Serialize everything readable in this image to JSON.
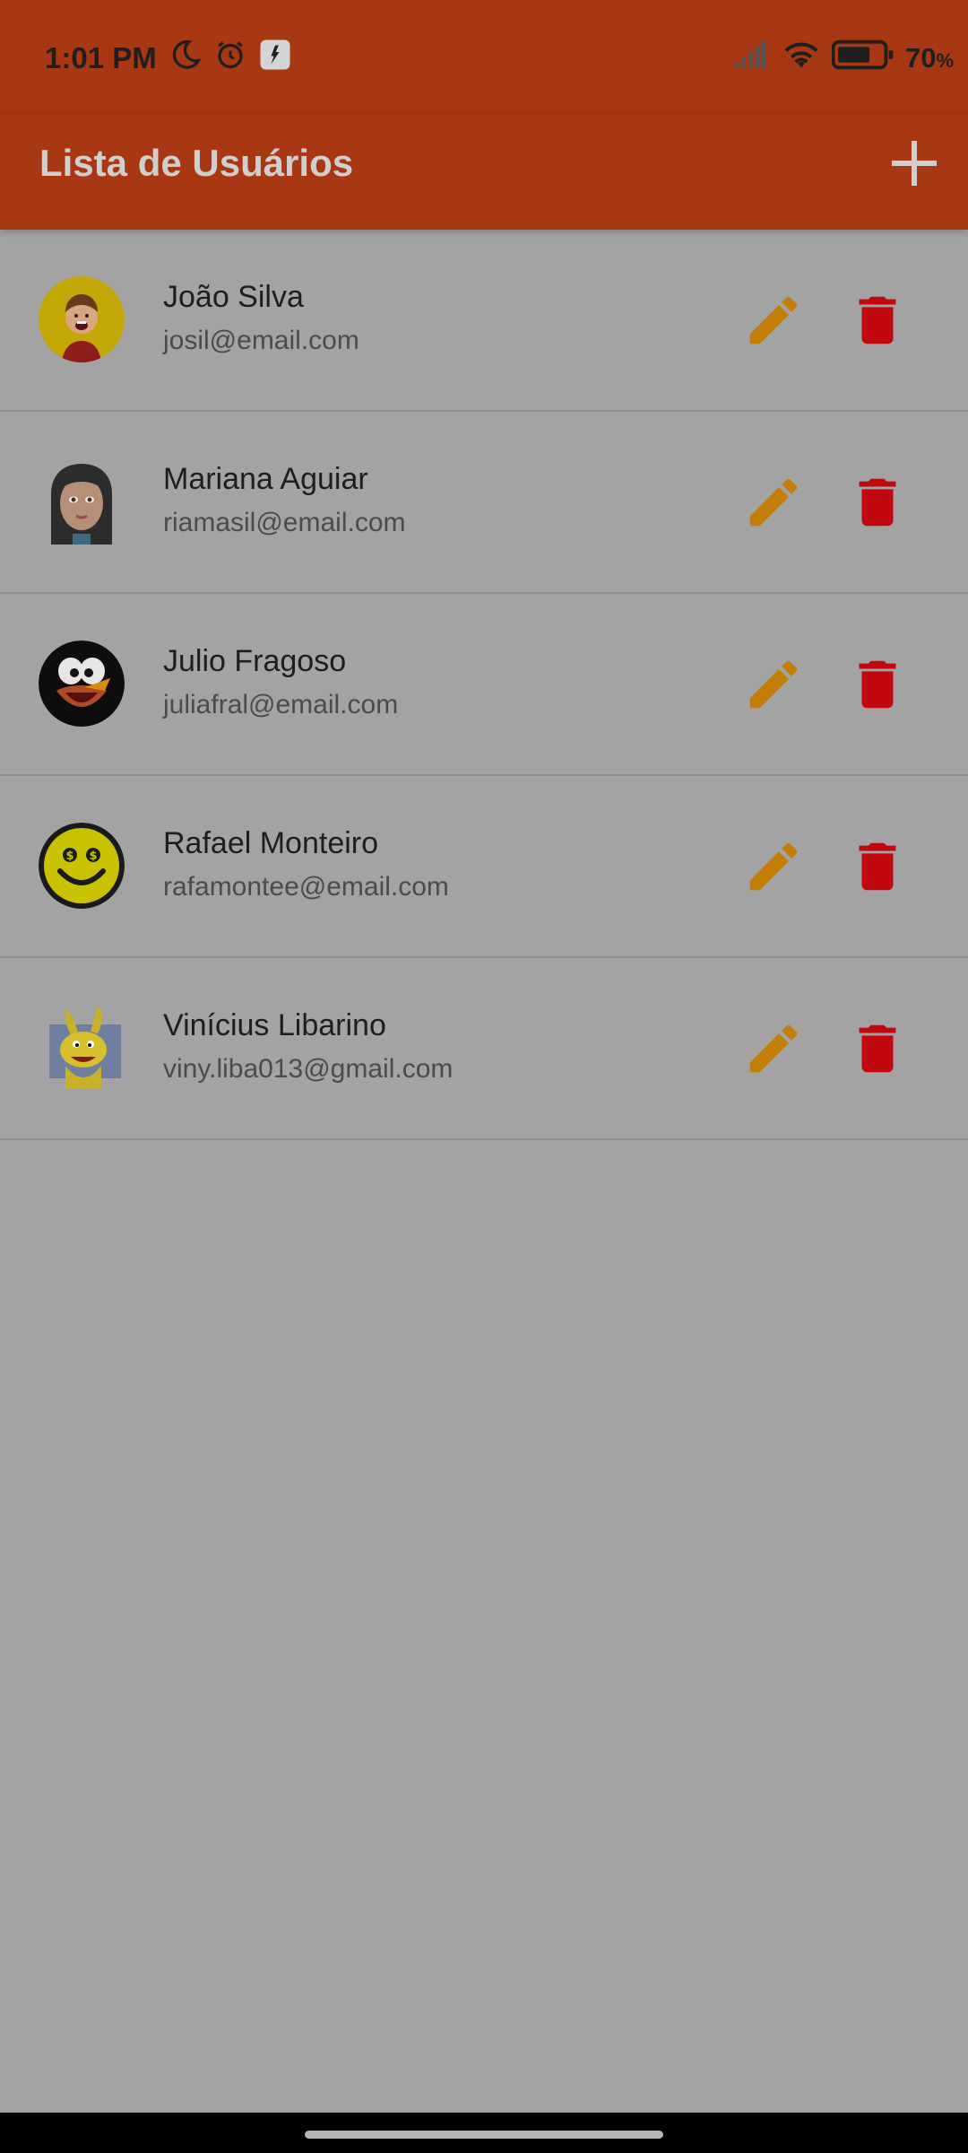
{
  "status_bar": {
    "time": "1:01 PM",
    "battery_percent": "70",
    "battery_unit": "%",
    "icons_left": [
      "moon-icon",
      "alarm-icon",
      "app-notification-icon"
    ],
    "icons_right": [
      "signal-icon",
      "wifi-icon",
      "battery-icon"
    ]
  },
  "app_bar": {
    "title": "Lista de Usuários",
    "action_icon": "plus-icon",
    "background": "#a83714"
  },
  "colors": {
    "edit": "#c47e08",
    "delete": "#c0080e",
    "list_background": "#a3a3a3"
  },
  "users": [
    {
      "name": "João Silva",
      "email": "josil@email.com",
      "avatar": "cartoon-boy"
    },
    {
      "name": "Mariana Aguiar",
      "email": "riamasil@email.com",
      "avatar": "cartoon-girl"
    },
    {
      "name": "Julio Fragoso",
      "email": "juliafral@email.com",
      "avatar": "cartoon-bird"
    },
    {
      "name": "Rafael Monteiro",
      "email": "rafamontee@email.com",
      "avatar": "money-smiley"
    },
    {
      "name": "Vinícius Libarino",
      "email": "viny.liba013@gmail.com",
      "avatar": "cartoon-rabbit"
    }
  ]
}
